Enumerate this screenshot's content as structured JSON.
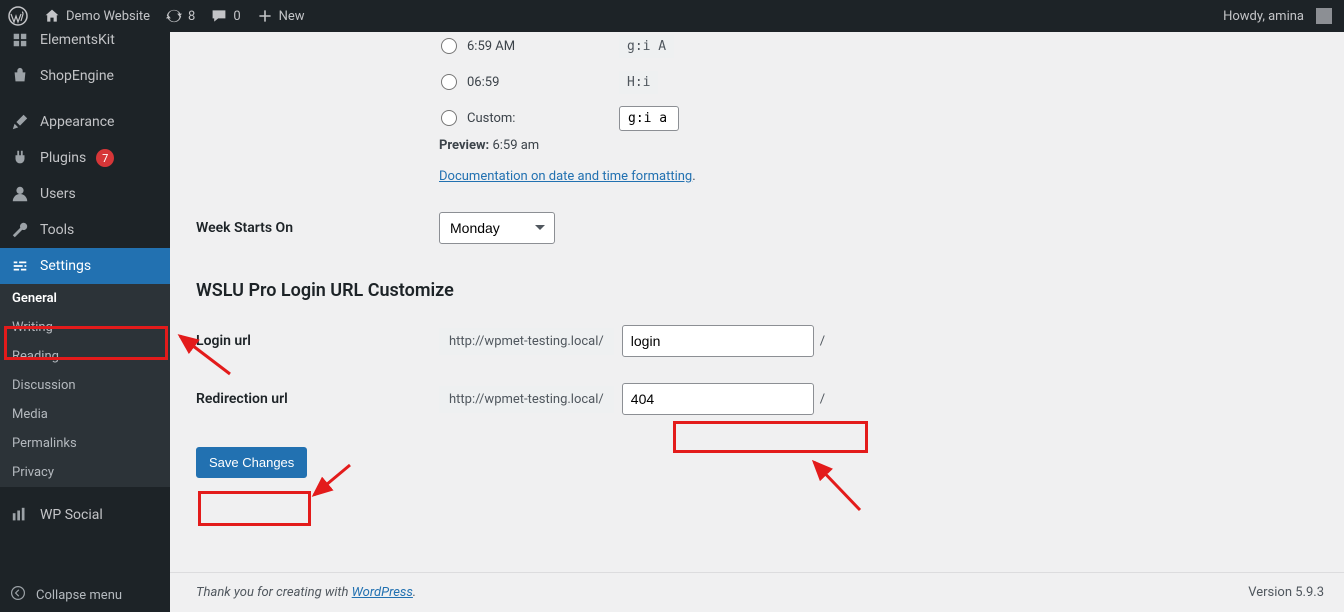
{
  "adminbar": {
    "site_name": "Demo Website",
    "updates_count": "8",
    "comments_count": "0",
    "new_label": "New",
    "howdy_prefix": "Howdy, ",
    "user_name": "amina"
  },
  "sidebar": {
    "items": [
      {
        "icon": "elementskit",
        "label": "ElementsKit"
      },
      {
        "icon": "shopengine",
        "label": "ShopEngine"
      },
      {
        "icon": "brush",
        "label": "Appearance"
      },
      {
        "icon": "plug",
        "label": "Plugins",
        "badge": "7"
      },
      {
        "icon": "user",
        "label": "Users"
      },
      {
        "icon": "wrench",
        "label": "Tools"
      },
      {
        "icon": "sliders",
        "label": "Settings",
        "current": true
      },
      {
        "icon": "wpsocial",
        "label": "WP Social"
      }
    ],
    "submenu": [
      {
        "label": "General",
        "current": true
      },
      {
        "label": "Writing"
      },
      {
        "label": "Reading"
      },
      {
        "label": "Discussion"
      },
      {
        "label": "Media"
      },
      {
        "label": "Permalinks"
      },
      {
        "label": "Privacy"
      }
    ],
    "collapse_label": "Collapse menu"
  },
  "time_format": {
    "opt_am_lg": "6:59 AM",
    "code_am_lg": "g:i A",
    "opt_24": "06:59",
    "code_24": "H:i",
    "opt_custom": "Custom:",
    "custom_value": "g:i a",
    "preview_label": "Preview:",
    "preview_value": " 6:59 am",
    "doc_link": "Documentation on date and time formatting",
    "doc_period": "."
  },
  "week": {
    "label": "Week Starts On",
    "value": "Monday"
  },
  "section_title": "WSLU Pro Login URL Customize",
  "login": {
    "label": "Login url",
    "prefix": "http://wpmet-testing.local/",
    "value": "login",
    "slash": "/"
  },
  "redirect": {
    "label": "Redirection url",
    "prefix": "http://wpmet-testing.local/",
    "value": "404",
    "slash": "/"
  },
  "save_label": "Save Changes",
  "footer": {
    "thank": "Thank you for creating with ",
    "wp": "WordPress",
    "period": ".",
    "version": "Version 5.9.3"
  }
}
